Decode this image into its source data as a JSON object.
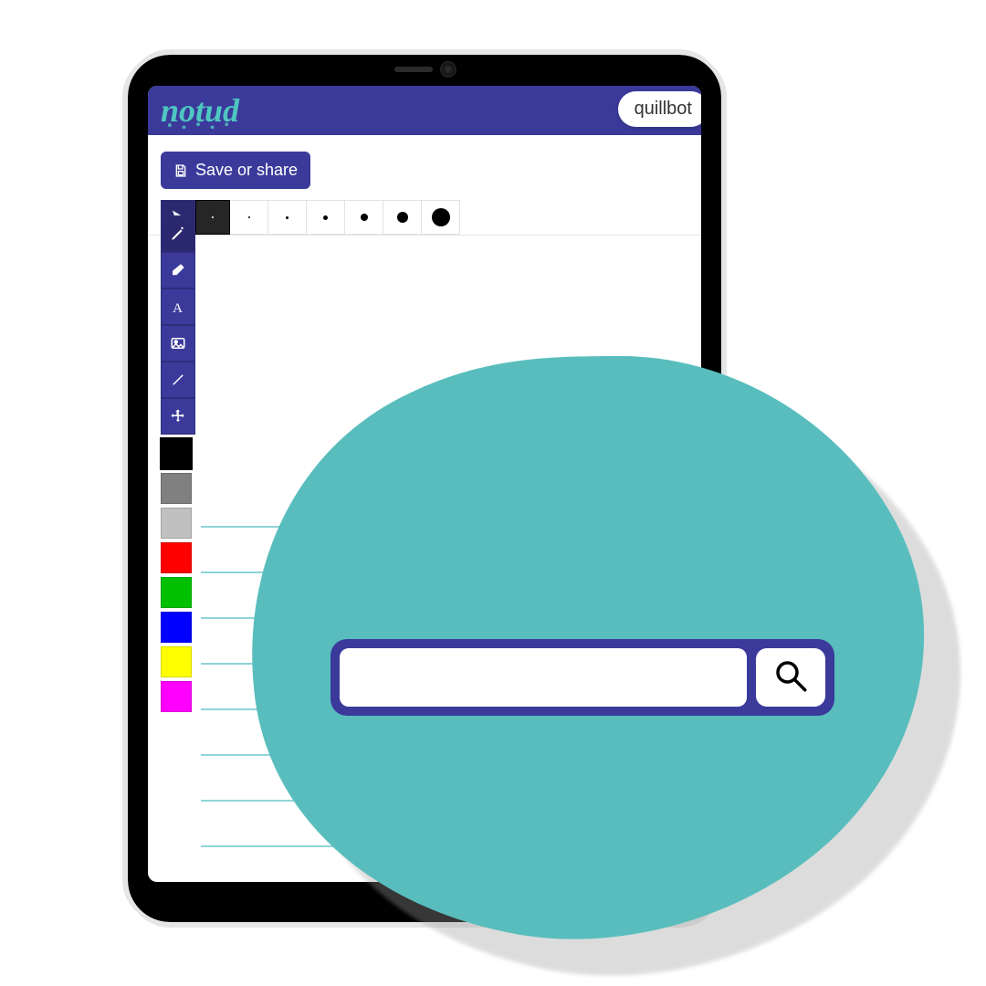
{
  "brand": {
    "name": "notud"
  },
  "header_chip": {
    "text": "quillbot"
  },
  "toolbar": {
    "save_label": "Save or share",
    "brush_sizes": [
      1,
      2,
      3,
      4,
      6,
      10,
      18
    ],
    "selected_size_index": 0
  },
  "tools": [
    {
      "id": "pointer",
      "icon": "pointer-icon"
    },
    {
      "id": "pencil",
      "icon": "pencil-icon"
    },
    {
      "id": "eraser",
      "icon": "eraser-icon"
    },
    {
      "id": "text",
      "icon": "text-icon"
    },
    {
      "id": "image",
      "icon": "image-icon"
    },
    {
      "id": "line",
      "icon": "line-icon"
    },
    {
      "id": "move",
      "icon": "move-icon"
    }
  ],
  "selected_tool_index": 0,
  "palette": {
    "colors": [
      "#000000",
      "#808080",
      "#c0c0c0",
      "#ff0000",
      "#00c000",
      "#0000ff",
      "#ffff00",
      "#ff00ff"
    ],
    "selected_index": 0
  },
  "blob": {
    "fill": "#59bdbd",
    "shadow": "#9e9e9e"
  },
  "search": {
    "value": "",
    "placeholder": ""
  }
}
